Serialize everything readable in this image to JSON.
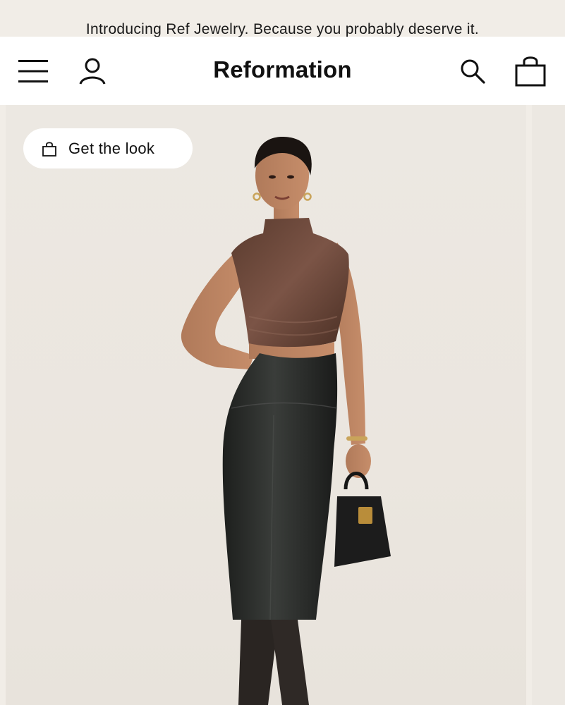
{
  "promo": {
    "text": "Introducing Ref Jewelry. Because you probably deserve it."
  },
  "header": {
    "logo": "Reformation",
    "icons": {
      "menu": "hamburger-menu-icon",
      "account": "user-icon",
      "search": "search-icon",
      "bag": "shopping-bag-icon"
    }
  },
  "hero": {
    "get_the_look_label": "Get the look",
    "image_alt": "Model wearing brown velvet sleeveless top and black leather midi skirt holding a black handbag"
  },
  "colors": {
    "background": "#f1ede7",
    "header_bg": "#ffffff",
    "text": "#111111",
    "pill_bg": "#ffffff"
  }
}
